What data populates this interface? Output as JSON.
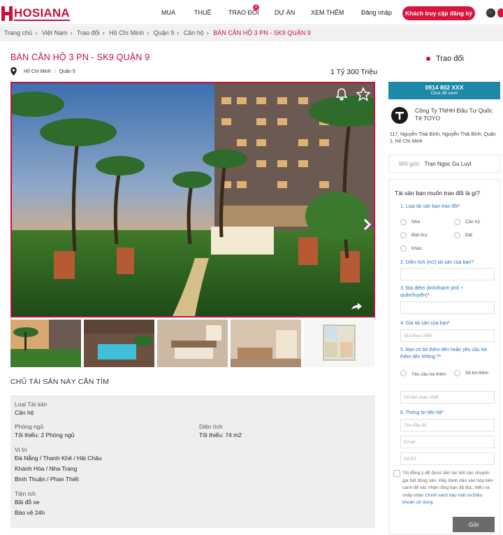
{
  "brand": {
    "name": "HOSIANA"
  },
  "nav": {
    "items": [
      "MUA",
      "THUÊ",
      "TRAO ĐỔI",
      "DỰ ÁN",
      "XEM THÊM"
    ],
    "notif_count": "2",
    "login": "Đăng nhập",
    "register": "Khách truy cập đăng ký"
  },
  "breadcrumb": [
    "Trang chủ",
    "Việt Nam",
    "Trao đổi",
    "Hồ Chí Minh",
    "Quận 9",
    "Căn hộ",
    "BÁN CĂN HỘ 3 PN - SK9 QUẬN 9"
  ],
  "listing": {
    "title": "BÁN CĂN HỘ 3 PN - SK9 QUẬN 9",
    "city": "Hồ Chí Minh",
    "district": "Quận 9",
    "price": "1 Tỷ 300 Triệu"
  },
  "requirements": {
    "heading": "CHỦ TÀI SẢN NÀY CẦN TÌM",
    "type_label": "Loại Tài sản",
    "type_value": "Căn hộ",
    "rooms_label": "Phòng ngủ",
    "rooms_value": "Tối thiểu: 2 Phòng ngủ",
    "area_label": "Diện tích",
    "area_value": "Tối thiểu: 74 m2",
    "location_label": "Vị trí",
    "locations": [
      "Đà Nẵng / Thanh Khê / Hải Châu",
      "Khánh Hòa / Nha Trang",
      "Bình Thuận / Phan Thiết"
    ],
    "amenities_label": "Tiện ích",
    "amenities": [
      "Bãi đỗ xe",
      "Bảo vệ 24h"
    ]
  },
  "sidebar": {
    "trade_heading": "Trao đổi",
    "phone": "0914 802 XXX",
    "phone_hint": "Click để xem!",
    "company_name": "Công Ty TNHH Đầu Tư Quốc Tế TOYO",
    "company_address": "117, Nguyễn Thái Bình, Nguyễn Thái Bình, Quận 1, Hồ Chí Minh",
    "broker_label": "Môi giới:",
    "broker_name": "Tran Ngoc Gu Luyt"
  },
  "form": {
    "heading": "Tài sản bạn muốn trao đổi là gì?",
    "q1": "1. Loại tài sản bạn trao đổi",
    "q1_options": [
      "Nhà",
      "Căn hộ",
      "Biệt thự",
      "Đất",
      "Khác"
    ],
    "q2": "2. Diện tích (m2) tài sản của bạn?",
    "q3": "3. Địa điểm (tỉnh/thành phố + quận/huyện)",
    "q4": "4. Giá tài sản của bạn",
    "q4_placeholder": "Giá theo VNĐ",
    "q5": "5. Bạn có bỏ thêm tiền hoặc yêu cầu trả thêm tiền không ?",
    "q5_options": [
      "Yêu cầu trả thêm",
      "Sẽ bỏ thêm"
    ],
    "q5_placeholder": "Số tiền theo VNĐ",
    "q6": "6. Thông tin liên hệ",
    "name_placeholder": "Tên đầy đủ",
    "email_placeholder": "Email",
    "phone_placeholder": "Số ĐT",
    "consent": "Tôi đồng ý để được liên lạc bởi các chuyên gia bất động sản. Hãy đánh dấu vào hộp bên cạnh để xác nhận rằng bạn đã đọc, hiểu và chấp nhận",
    "consent_link1": "Chính sách bảo mật",
    "consent_and": "và",
    "consent_link2": "Điều khoản sử dụng",
    "submit": "Gửi"
  },
  "colors": {
    "brand": "#c8103e",
    "phone_bar": "#1e88a8",
    "link": "#2873b9"
  }
}
